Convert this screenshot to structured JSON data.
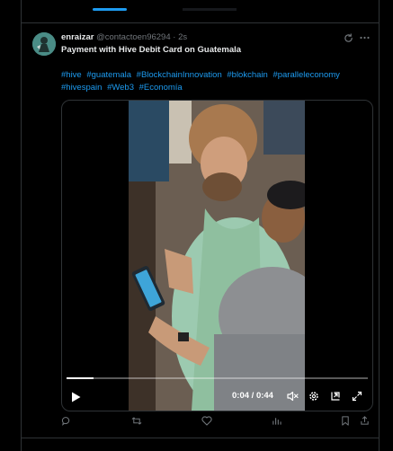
{
  "tweet": {
    "author_name": "enraizar",
    "handle": "@contactoen96294",
    "separator": "·",
    "time": "2s",
    "title": "Payment with Hive Debit Card on Guatemala",
    "hashtags": [
      "#hive",
      "#guatemala",
      "#BlockchainInnovation",
      "#blokchain",
      "#paralleleconomy",
      "#hivespain",
      "#Web3",
      "#Economía"
    ]
  },
  "video": {
    "current_time": "0:04",
    "time_separator": "/",
    "duration": "0:44",
    "progress": 0.09
  },
  "icons": {
    "grok": "grok-icon",
    "more": "more-icon",
    "play": "play-icon",
    "mute": "volume-mute-icon",
    "settings": "settings-gear-icon",
    "pip": "picture-in-picture-icon",
    "fullscreen": "fullscreen-icon",
    "reply": "reply-icon",
    "retweet": "retweet-icon",
    "like": "like-icon",
    "views": "views-icon",
    "bookmark": "bookmark-icon",
    "share": "share-icon"
  },
  "colors": {
    "accent": "#1d9bf0",
    "background": "#000000",
    "text": "#e7e9ea",
    "muted": "#71767b",
    "border": "#2f3336"
  }
}
